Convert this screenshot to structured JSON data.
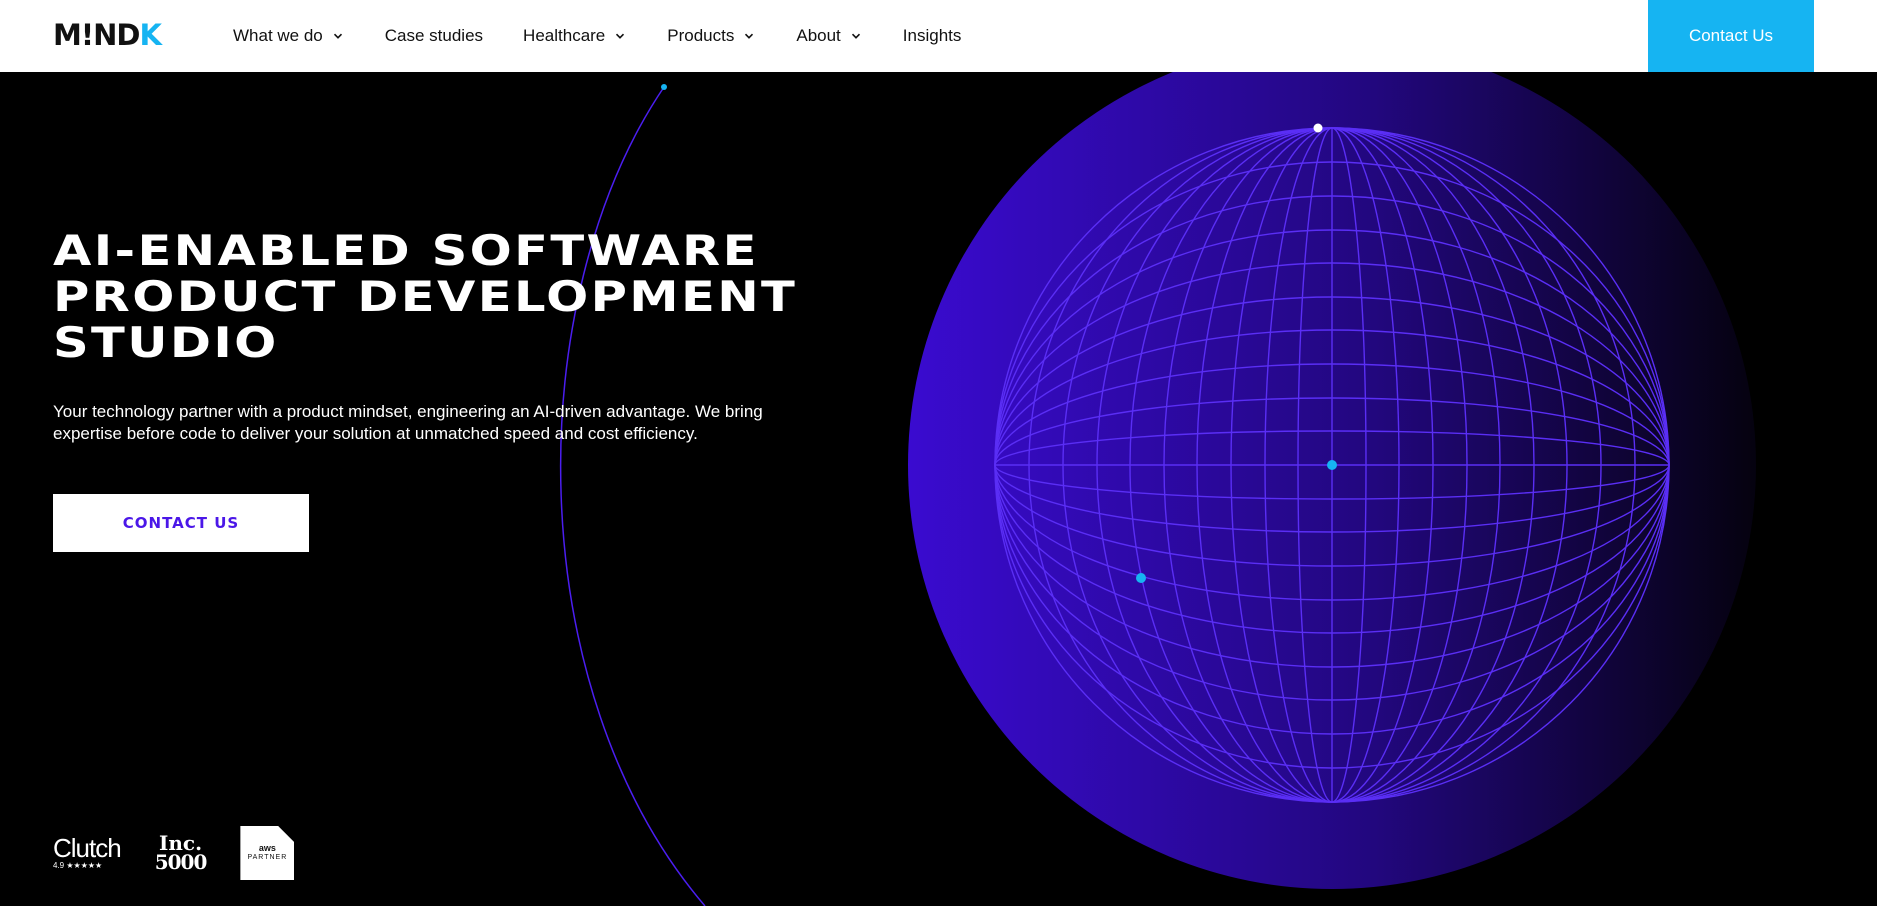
{
  "brand": {
    "logo_part1": "M",
    "logo_part2": "!",
    "logo_part3": "ND",
    "logo_part4": "K",
    "accent": "#16b4f2",
    "purple": "#4b17e8"
  },
  "nav": {
    "items": [
      {
        "label": "What we do",
        "dropdown": true
      },
      {
        "label": "Case studies",
        "dropdown": false
      },
      {
        "label": "Healthcare",
        "dropdown": true
      },
      {
        "label": "Products",
        "dropdown": true
      },
      {
        "label": "About",
        "dropdown": true
      },
      {
        "label": "Insights",
        "dropdown": false
      }
    ],
    "contact_label": "Contact Us"
  },
  "hero": {
    "title_lines": [
      "AI-ENABLED SOFTWARE",
      "PRODUCT DEVELOPMENT",
      "STUDIO"
    ],
    "subtitle": "Your technology partner with a product mindset, engineering an AI-driven advantage. We bring expertise before code to deliver your solution at unmatched speed and cost efficiency.",
    "cta_label": "CONTACT US"
  },
  "badges": {
    "clutch_name": "Clutch",
    "clutch_rating": "4.9 ★★★★★",
    "inc_line1": "Inc.",
    "inc_line2": "5000",
    "aws_line1": "aws",
    "aws_line2": "PARTNER"
  },
  "icons": {
    "chevron": "chevron-down-icon",
    "globe": "wireframe-globe-illustration"
  }
}
